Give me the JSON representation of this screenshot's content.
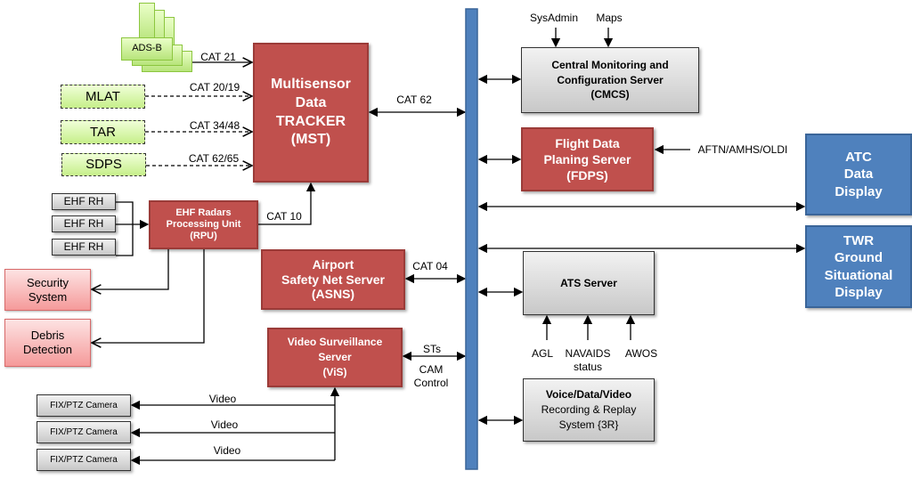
{
  "colors": {
    "server_red": "#c0504d",
    "display_blue": "#4f81bd",
    "bus_blue": "#4f81bd",
    "sensor_green": "#c6ef8a",
    "alert_pink": "#f59a9a",
    "grey": "#d9d9d9"
  },
  "sensors": {
    "adsb": "ADS-B",
    "mlat": "MLAT",
    "tar": "TAR",
    "sdps": "SDPS"
  },
  "mst": {
    "l1": "Multisensor",
    "l2": "Data",
    "l3": "TRACKER",
    "l4": "(MST)"
  },
  "links": {
    "cat21": "CAT 21",
    "cat2019": "CAT 20/19",
    "cat3448": "CAT 34/48",
    "cat6265": "CAT 62/65",
    "cat62": "CAT 62",
    "cat10": "CAT 10",
    "cat04": "CAT 04",
    "sts": "STs",
    "cam1": "CAM",
    "cam2": "Control",
    "video": "Video"
  },
  "ehf": {
    "rh": "EHF RH"
  },
  "rpu": {
    "l1": "EHF Radars",
    "l2": "Processing Unit",
    "l3": "(RPU)"
  },
  "security": {
    "l1": "Security",
    "l2": "System"
  },
  "debris": {
    "l1": "Debris",
    "l2": "Detection"
  },
  "asns": {
    "l1": "Airport",
    "l2": "Safety Net Server",
    "l3": "(ASNS)"
  },
  "vis": {
    "l1": "Video Surveillance",
    "l2": "Server",
    "l3": "(ViS)"
  },
  "camera": {
    "label": "FIX/PTZ Camera"
  },
  "cmcs": {
    "l1": "Central Monitoring and",
    "l2": "Configuration Server",
    "l3": "(CMCS)",
    "in1": "SysAdmin",
    "in2": "Maps"
  },
  "fdps": {
    "l1": "Flight Data",
    "l2": "Planing Server",
    "l3": "(FDPS)",
    "input": "AFTN/AMHS/OLDI"
  },
  "atc": {
    "l1": "ATC",
    "l2": "Data",
    "l3": "Display"
  },
  "twr": {
    "l1": "TWR",
    "l2": "Ground",
    "l3": "Situational",
    "l4": "Display"
  },
  "ats": {
    "title": "ATS Server",
    "in1": "AGL",
    "in2a": "NAVAIDS",
    "in2b": "status",
    "in3": "AWOS"
  },
  "rr": {
    "l1": "Voice/Data/Video",
    "l2": "Recording & Replay",
    "l3": "System {3R}"
  }
}
